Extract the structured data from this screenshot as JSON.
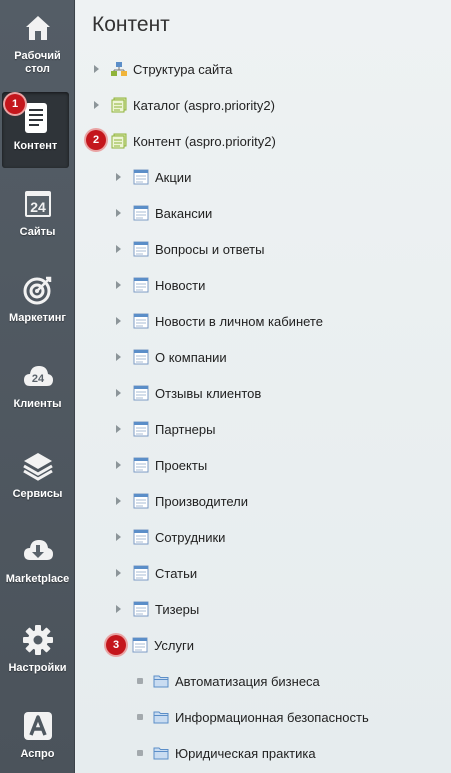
{
  "sidebar": {
    "items": [
      {
        "label": "Рабочий стол",
        "icon": "home-icon"
      },
      {
        "label": "Контент",
        "icon": "document-icon",
        "active": true
      },
      {
        "label": "Сайты",
        "icon": "calendar-24-icon"
      },
      {
        "label": "Маркетинг",
        "icon": "target-icon"
      },
      {
        "label": "Клиенты",
        "icon": "cloud-24-icon"
      },
      {
        "label": "Сервисы",
        "icon": "layers-icon"
      },
      {
        "label": "Marketplace",
        "icon": "cloud-download-icon"
      },
      {
        "label": "Настройки",
        "icon": "gear-icon"
      },
      {
        "label": "Аспро",
        "icon": "letter-a-icon"
      }
    ]
  },
  "badges": {
    "one": "1",
    "two": "2",
    "three": "3"
  },
  "page": {
    "title": "Контент"
  },
  "tree": {
    "roots": [
      {
        "label": "Структура сайта"
      },
      {
        "label": "Каталог (aspro.priority2)"
      },
      {
        "label": "Контент (aspro.priority2)"
      }
    ],
    "content_children": [
      {
        "label": "Акции"
      },
      {
        "label": "Вакансии"
      },
      {
        "label": "Вопросы и ответы"
      },
      {
        "label": "Новости"
      },
      {
        "label": "Новости в личном кабинете"
      },
      {
        "label": "О компании"
      },
      {
        "label": "Отзывы клиентов"
      },
      {
        "label": "Партнеры"
      },
      {
        "label": "Проекты"
      },
      {
        "label": "Производители"
      },
      {
        "label": "Сотрудники"
      },
      {
        "label": "Статьи"
      },
      {
        "label": "Тизеры"
      },
      {
        "label": "Услуги"
      }
    ],
    "services_children": [
      {
        "label": "Автоматизация бизнеса"
      },
      {
        "label": "Информационная безопасность"
      },
      {
        "label": "Юридическая практика"
      }
    ]
  },
  "colors": {
    "sidebar": "#4f5860",
    "badge": "#c4161c",
    "accent_green": "#8fb33a",
    "folder_blue": "#5b8ec8"
  }
}
